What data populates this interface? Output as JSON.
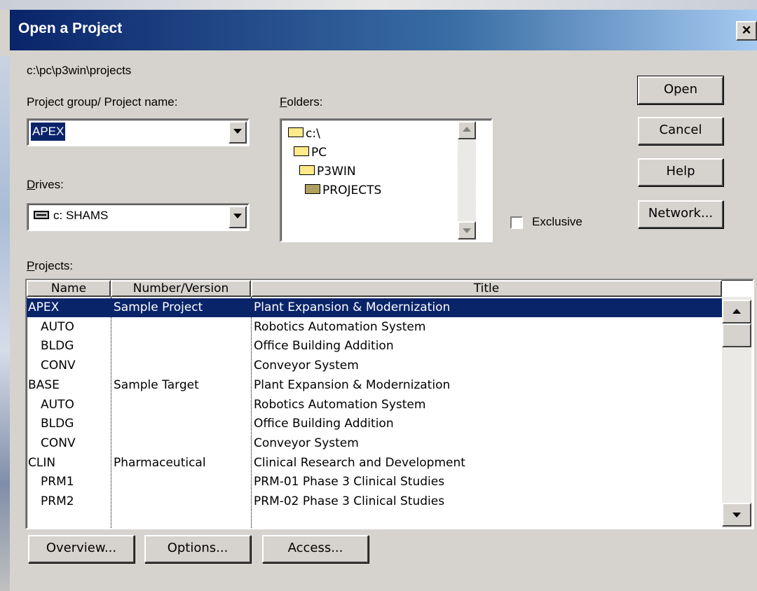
{
  "window": {
    "title": "Open a Project",
    "close_label": "×"
  },
  "path": "c:\\pc\\p3win\\projects",
  "project_group": {
    "label": "Project group/ Project name:",
    "value": "APEX"
  },
  "drives": {
    "label": "Drives:",
    "value": "c: SHAMS"
  },
  "folders": {
    "label": "Folders:",
    "items": [
      {
        "name": "c:\\",
        "state": "open"
      },
      {
        "name": "PC",
        "state": "open"
      },
      {
        "name": "P3WIN",
        "state": "open"
      },
      {
        "name": "PROJECTS",
        "state": "closed"
      }
    ]
  },
  "exclusive": {
    "label": "Exclusive",
    "checked": false
  },
  "buttons": {
    "open": "Open",
    "cancel": "Cancel",
    "help": "Help",
    "network": "Network..."
  },
  "projects": {
    "label": "Projects:",
    "columns": [
      "Name",
      "Number/Version",
      "Title"
    ],
    "rows": [
      {
        "name": "APEX",
        "version": "Sample Project",
        "title": "Plant Expansion & Modernization",
        "selected": true,
        "indent": false
      },
      {
        "name": "AUTO",
        "version": "",
        "title": "Robotics Automation System",
        "selected": false,
        "indent": true
      },
      {
        "name": "BLDG",
        "version": "",
        "title": "Office Building Addition",
        "selected": false,
        "indent": true
      },
      {
        "name": "CONV",
        "version": "",
        "title": "Conveyor System",
        "selected": false,
        "indent": true
      },
      {
        "name": "BASE",
        "version": "Sample Target",
        "title": "Plant Expansion & Modernization",
        "selected": false,
        "indent": false
      },
      {
        "name": "AUTO",
        "version": "",
        "title": "Robotics Automation System",
        "selected": false,
        "indent": true
      },
      {
        "name": "BLDG",
        "version": "",
        "title": "Office Building Addition",
        "selected": false,
        "indent": true
      },
      {
        "name": "CONV",
        "version": "",
        "title": "Conveyor System",
        "selected": false,
        "indent": true
      },
      {
        "name": "CLIN",
        "version": "Pharmaceutical",
        "title": "Clinical Research and Development",
        "selected": false,
        "indent": false
      },
      {
        "name": "PRM1",
        "version": "",
        "title": "PRM-01 Phase 3 Clinical Studies",
        "selected": false,
        "indent": true
      },
      {
        "name": "PRM2",
        "version": "",
        "title": "PRM-02 Phase 3 Clinical Studies",
        "selected": false,
        "indent": true
      }
    ]
  },
  "bottom_buttons": {
    "overview": "Overview...",
    "options": "Options...",
    "access": "Access..."
  },
  "colors": {
    "titlebar": "#0a246a",
    "selection": "#0a246a",
    "face": "#d6d3ce"
  }
}
